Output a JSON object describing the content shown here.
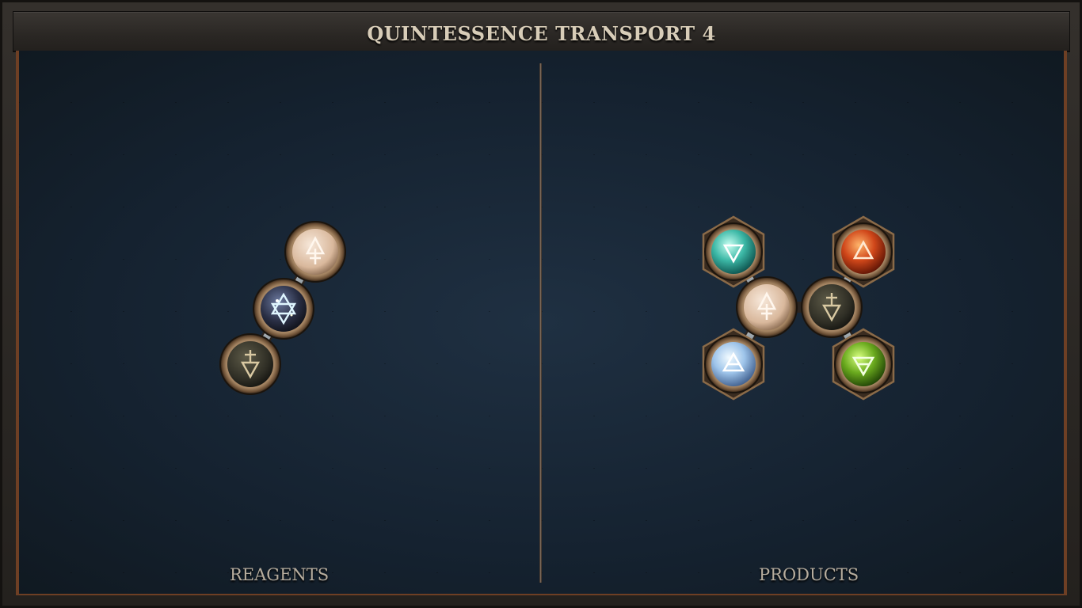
{
  "title": "QUINTESSENCE TRANSPORT 4",
  "panels": {
    "left_label": "REAGENTS",
    "right_label": "PRODUCTS"
  },
  "colors": {
    "salt": "#e2c7ae",
    "quintessence": "#25345a",
    "mors": "#3b3a2e",
    "water": "#3fb8a8",
    "fire": "#d0471a",
    "air": "#9ec4ea",
    "earth": "#6aaa1e",
    "bond": "#c4ccd2",
    "frame_bronze": "#8a6a48"
  },
  "reagents": [
    {
      "element": "salt",
      "icon": "salt-icon"
    },
    {
      "element": "quintessence",
      "icon": "quintessence-icon"
    },
    {
      "element": "mors",
      "icon": "mors-icon"
    }
  ],
  "products": [
    {
      "element": "water",
      "icon": "water-icon"
    },
    {
      "element": "fire",
      "icon": "fire-icon"
    },
    {
      "element": "salt",
      "icon": "salt-icon"
    },
    {
      "element": "mors",
      "icon": "mors-icon"
    },
    {
      "element": "air",
      "icon": "air-icon"
    },
    {
      "element": "earth",
      "icon": "earth-icon"
    }
  ]
}
